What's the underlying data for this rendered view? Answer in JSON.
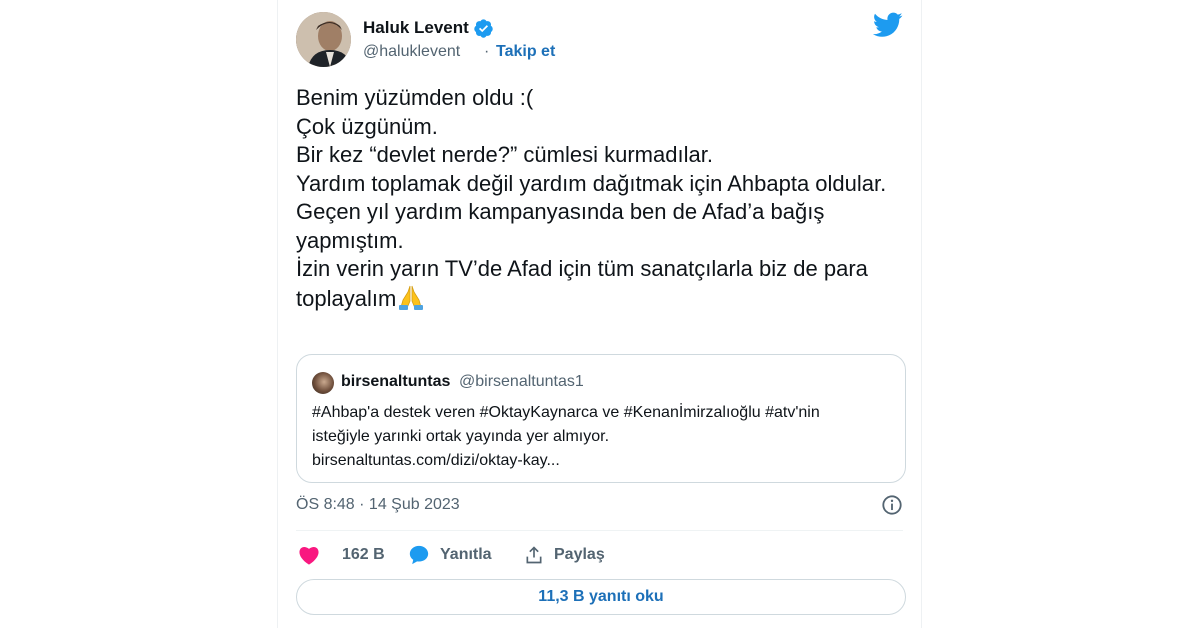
{
  "author": {
    "name": "Haluk Levent",
    "handle": "@haluklevent",
    "separator": "·",
    "follow_label": "Takip et",
    "verified": true
  },
  "tweet": {
    "text": "Benim yüzümden oldu :(\nÇok üzgünüm.\nBir kez “devlet nerde?” cümlesi kurmadılar.\nYardım toplamak değil yardım dağıtmak için Ahbapta oldular.\nGeçen yıl yardım kampanyasında ben de Afad’a bağış yapmıştım.\nİzin verin yarın TV’de Afad için tüm sanatçılarla biz de para toplayalım",
    "emoji": "folded-hands"
  },
  "quote": {
    "name": "birsenaltuntas",
    "handle": "@birsenaltuntas1",
    "text_line1": "#Ahbap'a destek veren #OktayKaynarca ve #Kenanİmirzalıoğlu #atv'nin",
    "text_line2": "isteğiyle yarınki ortak yayında yer almıyor.",
    "text_line3": "birsenaltuntas.com/dizi/oktay-kay..."
  },
  "meta": {
    "timestamp": "ÖS 8:48 · 14 Şub 2023"
  },
  "actions": {
    "likes": "162 B",
    "reply_label": "Yanıtla",
    "share_label": "Paylaş"
  },
  "read_replies_label": "11,3 B yanıtı oku",
  "colors": {
    "accent": "#1d9bf0",
    "link": "#1d70b8",
    "like": "#f91880",
    "text": "#0f1419",
    "muted": "#536471",
    "border": "#cfd9de"
  }
}
